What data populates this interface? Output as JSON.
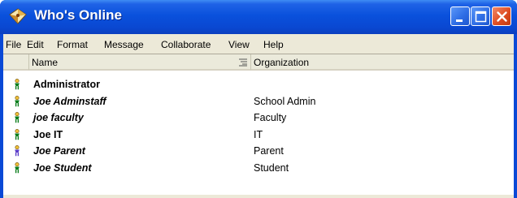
{
  "window": {
    "title": "Who's Online"
  },
  "titlebar_buttons": [
    "minimize",
    "maximize",
    "close"
  ],
  "menu": [
    "File",
    "Edit",
    "Format",
    "Message",
    "Collaborate",
    "View",
    "Help"
  ],
  "columns": {
    "name": "Name",
    "organization": "Organization"
  },
  "users": [
    {
      "name": "Administrator",
      "organization": "",
      "italic": false,
      "status_color": "#0a7d1c"
    },
    {
      "name": "Joe Adminstaff",
      "organization": "School Admin",
      "italic": true,
      "status_color": "#0a7d1c"
    },
    {
      "name": "joe faculty",
      "organization": "Faculty",
      "italic": true,
      "status_color": "#0a7d1c"
    },
    {
      "name": "Joe IT",
      "organization": "IT",
      "italic": false,
      "status_color": "#0a7d1c"
    },
    {
      "name": "Joe Parent",
      "organization": "Parent",
      "italic": true,
      "status_color": "#5a3cc8"
    },
    {
      "name": "Joe Student",
      "organization": "Student",
      "italic": true,
      "status_color": "#0a7d1c"
    }
  ],
  "icons": {
    "app": "chat-bubble-icon",
    "status": "user-status-icon",
    "sort": "sort-indicator-icon"
  }
}
